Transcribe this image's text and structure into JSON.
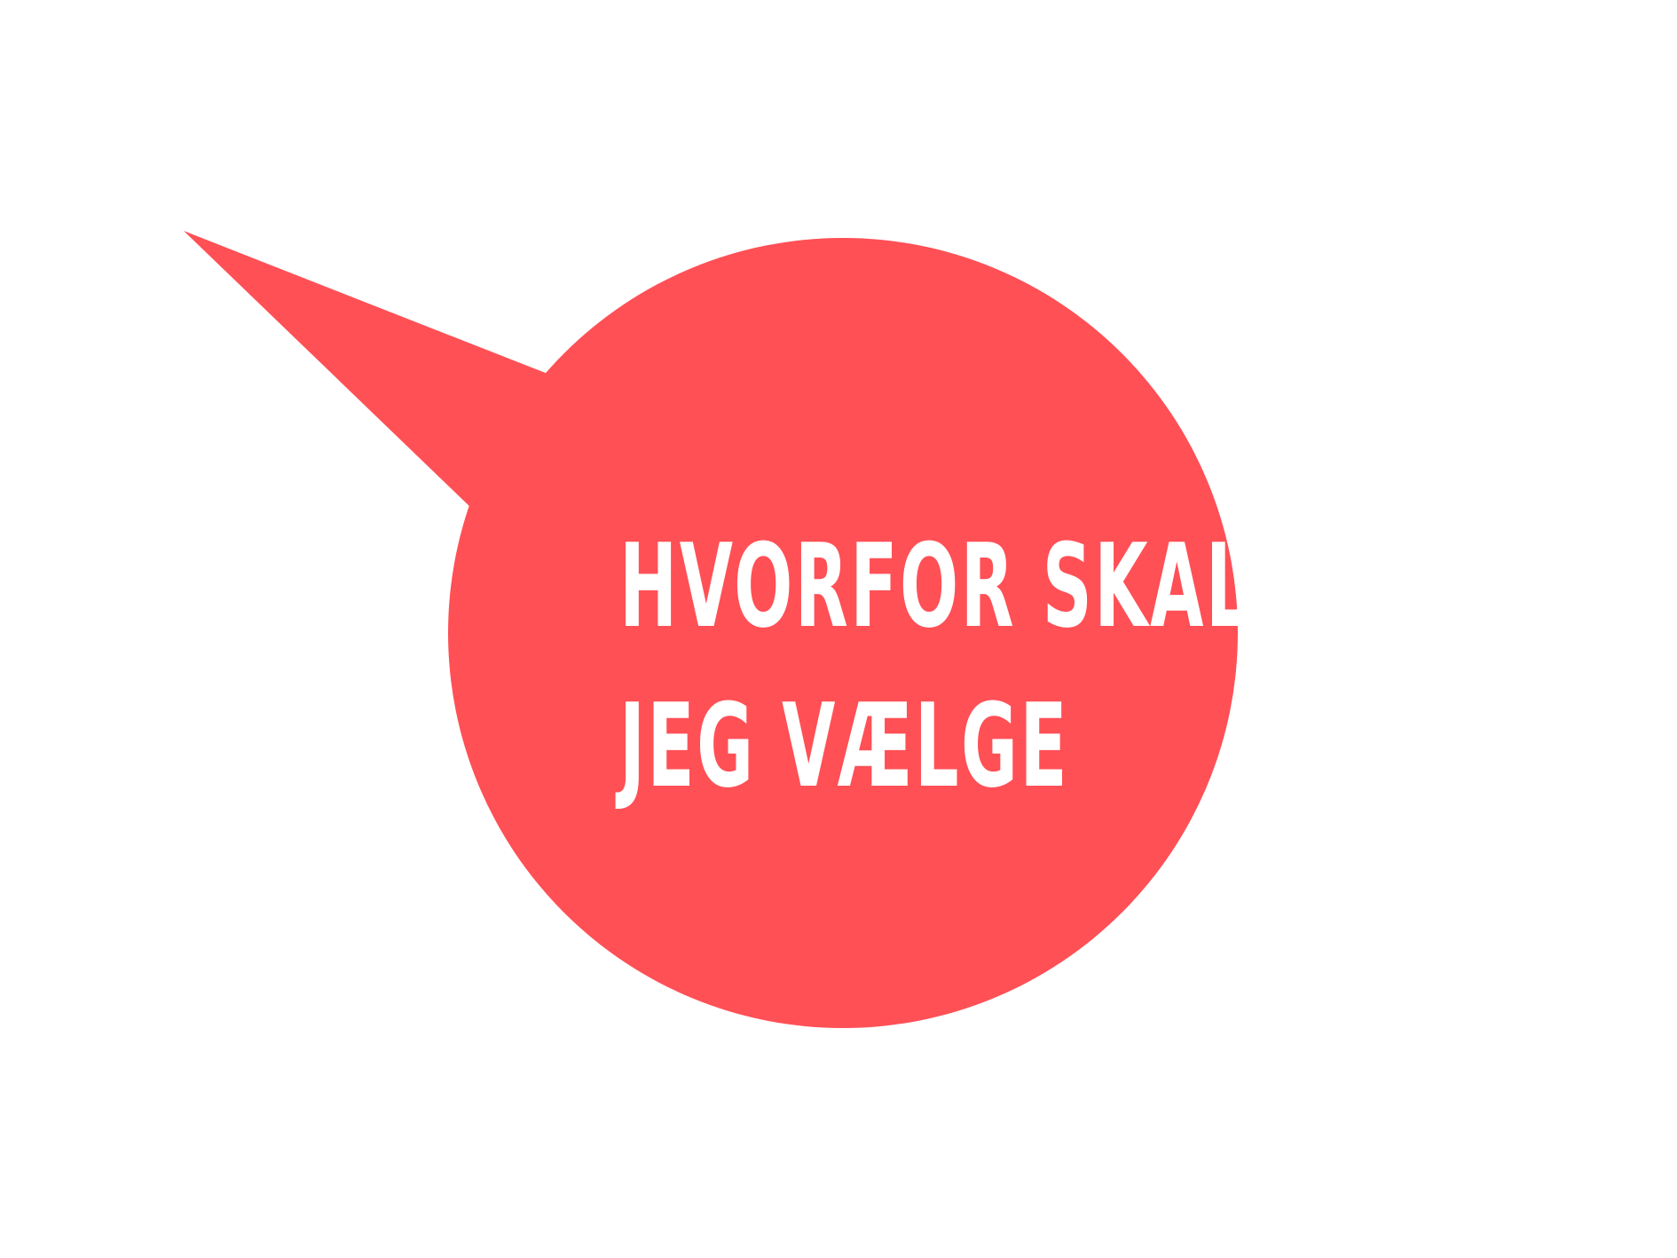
{
  "bubble": {
    "line1": "HVORFOR SKAL",
    "line2": "JEG VÆLGE",
    "fill_color": "#FF5056",
    "text_color": "#FFFFFF",
    "background_color": "#FFFFFF"
  }
}
